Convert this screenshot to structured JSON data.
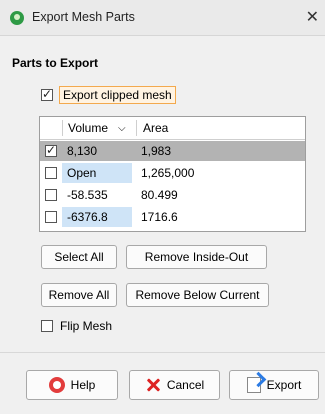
{
  "window": {
    "title": "Export Mesh Parts",
    "close_glyph": "✕"
  },
  "section": {
    "title": "Parts to Export"
  },
  "export_clipped": {
    "label": "Export clipped mesh",
    "checked": true
  },
  "table": {
    "headers": {
      "volume": "Volume",
      "area": "Area",
      "sort_glyph": "⌵"
    },
    "rows": [
      {
        "checked": true,
        "volume": "8,130",
        "area": "1,983"
      },
      {
        "checked": false,
        "volume": "Open",
        "area": "1,265,000"
      },
      {
        "checked": false,
        "volume": "-58.535",
        "area": "80.499"
      },
      {
        "checked": false,
        "volume": "-6376.8",
        "area": "1716.6"
      }
    ]
  },
  "buttons": {
    "select_all": "Select All",
    "remove_inside_out": "Remove Inside-Out",
    "remove_all": "Remove All",
    "remove_below_current": "Remove Below Current"
  },
  "flip_mesh": {
    "label": "Flip Mesh",
    "checked": false
  },
  "footer": {
    "help": "Help",
    "cancel": "Cancel",
    "export": "Export"
  }
}
